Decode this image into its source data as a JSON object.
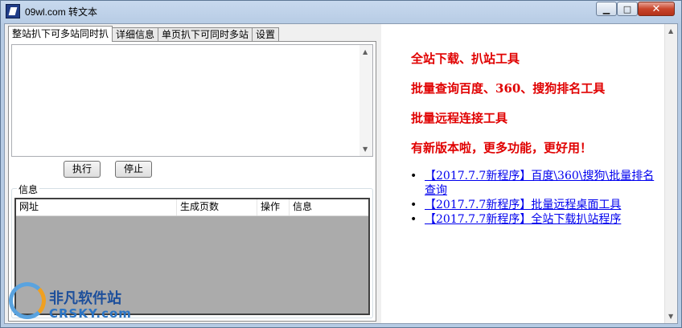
{
  "window": {
    "title": "09wl.com 转文本",
    "minimize_glyph": "▁",
    "maximize_glyph": "□",
    "close_glyph": "✕"
  },
  "tabs": [
    {
      "label": "整站扒下可多站同时扒",
      "active": true
    },
    {
      "label": "详细信息",
      "active": false
    },
    {
      "label": "单页扒下可同时多站",
      "active": false
    },
    {
      "label": "设置",
      "active": false
    }
  ],
  "main": {
    "url_input_value": "",
    "run_button": "执行",
    "stop_button": "停止",
    "info_group_label": "信息",
    "list_columns": [
      "网址",
      "生成页数",
      "操作",
      "信息"
    ]
  },
  "promo": {
    "lines": [
      "全站下载、扒站工具",
      "批量查询百度、360、搜狗排名工具",
      "批量远程连接工具",
      "有新版本啦，更多功能，更好用！"
    ],
    "color": "#e00000"
  },
  "links": [
    "【2017.7.7新程序】百度\\360\\搜狗\\批量排名查询",
    "【2017.7.7新程序】批量远程桌面工具",
    "【2017.7.7新程序】全站下载扒站程序"
  ],
  "watermark": {
    "text": "非凡软件站",
    "sub": "CRSKY.com"
  },
  "scroll": {
    "up": "▲",
    "down": "▼"
  }
}
